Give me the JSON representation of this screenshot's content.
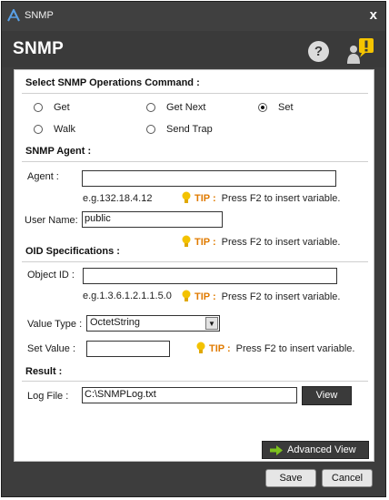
{
  "window": {
    "title": "SNMP",
    "close_glyph": "x"
  },
  "header": {
    "title": "SNMP",
    "help_glyph": "?"
  },
  "operations": {
    "heading": "Select SNMP Operations Command :",
    "options": [
      {
        "label": "Get",
        "selected": false
      },
      {
        "label": "Get Next",
        "selected": false
      },
      {
        "label": "Set",
        "selected": true
      },
      {
        "label": "Walk",
        "selected": false
      },
      {
        "label": "Send Trap",
        "selected": false
      }
    ]
  },
  "agent": {
    "heading": "SNMP Agent :",
    "agent_label": "Agent :",
    "agent_value": "",
    "agent_example": "e.g.132.18.4.12",
    "user_label": "User Name:",
    "user_value": "public"
  },
  "oid": {
    "heading": "OID Specifications :",
    "object_label": "Object ID :",
    "object_value": "",
    "object_example": "e.g.1.3.6.1.2.1.1.5.0",
    "value_type_label": "Value Type :",
    "value_type_selected": "OctetString",
    "set_value_label": "Set Value :",
    "set_value": ""
  },
  "tip": {
    "key": "TIP :",
    "text": "Press F2 to insert variable."
  },
  "result": {
    "heading": "Result :",
    "log_label": "Log File :",
    "log_value": "C:\\SNMPLog.txt",
    "view_label": "View"
  },
  "footer": {
    "advanced_label": "Advanced View",
    "save_label": "Save",
    "cancel_label": "Cancel"
  },
  "colors": {
    "accent_tip": "#e07b00",
    "bulb": "#f3c200",
    "arrow_green": "#7dc21e",
    "alert_yellow": "#f5c400"
  },
  "icons": [
    "app-logo-icon",
    "close-icon",
    "help-icon",
    "user-alert-icon",
    "lightbulb-icon",
    "dropdown-arrow-icon",
    "arrow-right-icon"
  ]
}
